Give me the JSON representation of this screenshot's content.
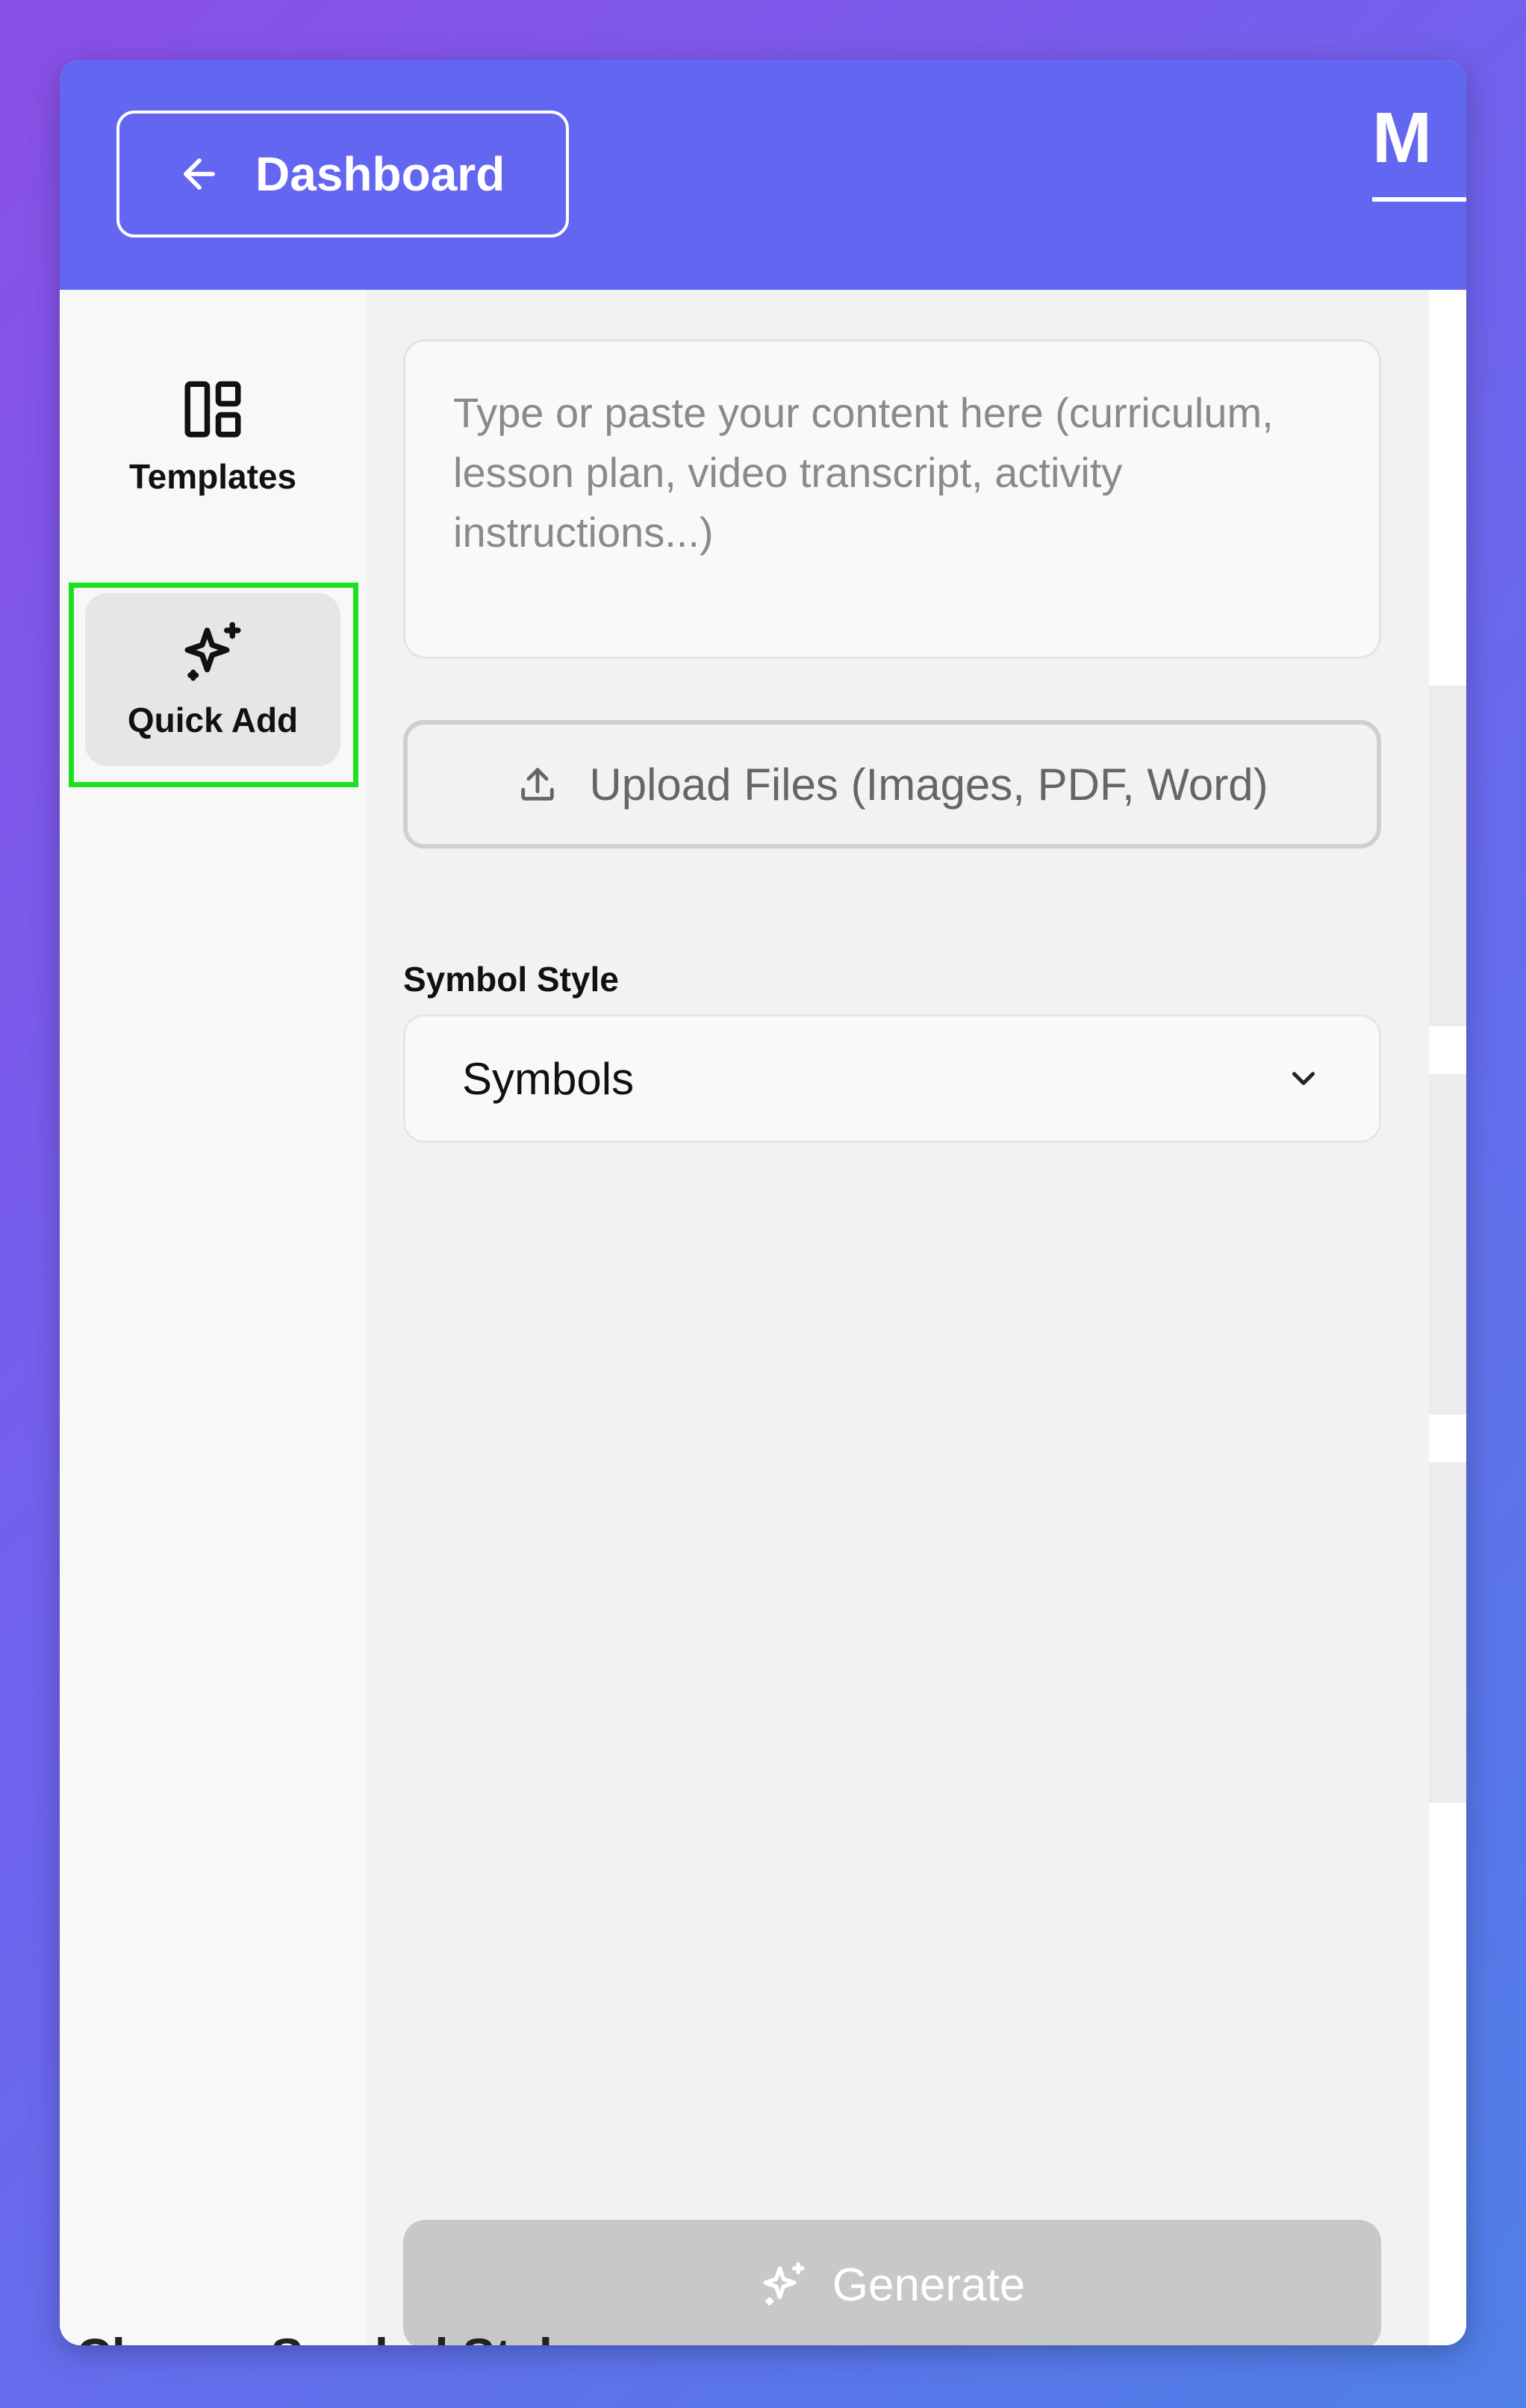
{
  "header": {
    "back_label": "Dashboard",
    "title_partial": "M",
    "background": "#6366f1"
  },
  "sidebar": {
    "items": [
      {
        "label": "Templates",
        "icon": "layout-grid-icon",
        "active": false
      },
      {
        "label": "Quick Add",
        "icon": "sparkles-icon",
        "active": true
      }
    ],
    "highlight_color": "#1fe01f"
  },
  "main": {
    "content_placeholder": "Type or paste your content here (curriculum, lesson plan, video transcript, activity instructions...)",
    "upload_label": "Upload Files (Images, PDF, Word)",
    "symbol_style_label": "Symbol Style",
    "symbol_style_value": "Symbols",
    "generate_label": "Generate"
  },
  "background_peek": {
    "text": "Choose Symbol Style:"
  },
  "colors": {
    "accent": "#6366f1",
    "disabled_button": "#c8c8c8"
  }
}
